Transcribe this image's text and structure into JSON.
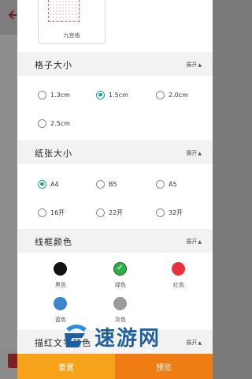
{
  "background": {
    "back_icon": "arrow-left-icon"
  },
  "template": {
    "label": "九宫格"
  },
  "sections": {
    "grid_size": {
      "title": "格子大小",
      "toggle": "展开",
      "options": [
        "1.3cm",
        "1.5cm",
        "2.0cm",
        "2.5cm"
      ],
      "selected": "1.5cm"
    },
    "paper_size": {
      "title": "纸张大小",
      "toggle": "展开",
      "options": [
        "A4",
        "B5",
        "A5",
        "16开",
        "22开",
        "32开"
      ],
      "selected": "A4"
    },
    "line_color": {
      "title": "线框颜色",
      "toggle": "展开",
      "colors": [
        {
          "label": "黑色",
          "hex": "#111111"
        },
        {
          "label": "绿色",
          "hex": "#2bb24c"
        },
        {
          "label": "红色",
          "hex": "#e8303a"
        },
        {
          "label": "蓝色",
          "hex": "#3a86c8"
        },
        {
          "label": "灰色",
          "hex": "#9b9b9b"
        }
      ],
      "selected": "绿色"
    },
    "trace_text_color": {
      "title": "描红文字颜色",
      "toggle": "展开"
    }
  },
  "bottom": {
    "reset_label": "重置",
    "preview_label": "预览"
  },
  "watermark": {
    "text": "速游网",
    "sub": "WWW.SUYOU.COM"
  },
  "colors": {
    "accent_radio": "#1aa58a",
    "reset_bg": "#f6a21a",
    "preview_bg": "#ef7d14"
  }
}
